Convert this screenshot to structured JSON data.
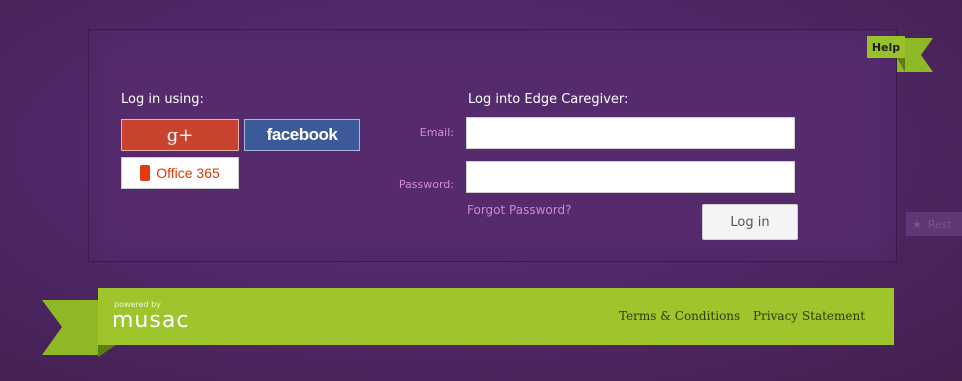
{
  "colors": {
    "background": "#4f2660",
    "panel": "#552b6d",
    "accent_green": "#9fc52d",
    "label_pink": "#d58bd6",
    "google_red": "#c9432e",
    "facebook_blue": "#3d5a98",
    "office_orange": "#d83b01"
  },
  "help": {
    "label": "Help"
  },
  "social_login": {
    "title": "Log in using:",
    "google_label": "g+",
    "facebook_label": "facebook",
    "office_label": "Office 365"
  },
  "login_form": {
    "title": "Log into Edge Caregiver:",
    "email_label": "Email:",
    "email_value": "",
    "password_label": "Password:",
    "password_value": "",
    "forgot_link": "Forgot Password?",
    "submit_label": "Log in"
  },
  "side_tab": {
    "icon": "star-icon",
    "label": "Rest"
  },
  "footer": {
    "powered_by": "powered by",
    "logo": "musac",
    "links": [
      "Terms & Conditions",
      "Privacy Statement"
    ]
  }
}
